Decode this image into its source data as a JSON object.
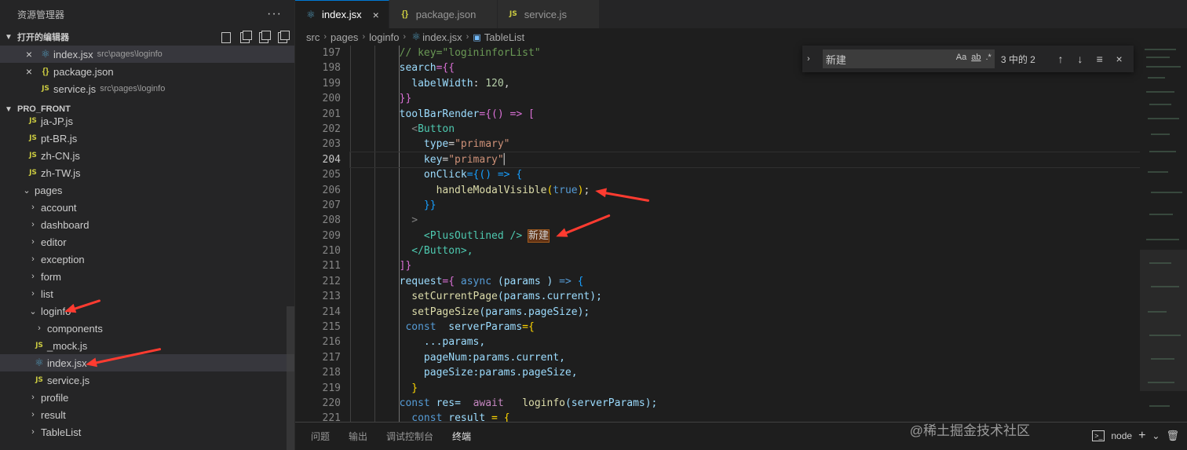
{
  "sidebar": {
    "title": "资源管理器",
    "more": "···",
    "open_editors": {
      "header": "打开的编辑器",
      "items": [
        {
          "close": "×",
          "name": "index.jsx",
          "path": "src\\pages\\loginfo"
        },
        {
          "close": "×",
          "name": "package.json",
          "path": ""
        },
        {
          "name": "service.js",
          "path": "src\\pages\\loginfo"
        }
      ]
    },
    "project": {
      "header": "PRO_FRONT",
      "items": [
        {
          "label": "ja-JP.js"
        },
        {
          "label": "pt-BR.js"
        },
        {
          "label": "zh-CN.js"
        },
        {
          "label": "zh-TW.js"
        },
        {
          "label": "pages"
        },
        {
          "label": "account"
        },
        {
          "label": "dashboard"
        },
        {
          "label": "editor"
        },
        {
          "label": "exception"
        },
        {
          "label": "form"
        },
        {
          "label": "list"
        },
        {
          "label": "loginfo"
        },
        {
          "label": "components"
        },
        {
          "label": "_mock.js"
        },
        {
          "label": "index.jsx"
        },
        {
          "label": "service.js"
        },
        {
          "label": "profile"
        },
        {
          "label": "result"
        },
        {
          "label": "TableList"
        }
      ]
    }
  },
  "tabs": [
    {
      "label": "index.jsx",
      "close": "×"
    },
    {
      "label": "package.json"
    },
    {
      "label": "service.js"
    }
  ],
  "breadcrumb": {
    "parts": [
      "src",
      "pages",
      "loginfo",
      "index.jsx",
      "TableList"
    ],
    "sep": "›"
  },
  "icons": {
    "js": "JS",
    "json": "{}",
    "react": "⚛"
  },
  "find": {
    "value": "新建",
    "opt_case": "Aa",
    "opt_word": "ab",
    "opt_regex": ".*",
    "count": "3 中的 2",
    "prev": "↑",
    "next": "↓",
    "sel": "≡",
    "close": "×"
  },
  "lines": [
    "197",
    "198",
    "199",
    "200",
    "201",
    "202",
    "203",
    "204",
    "205",
    "206",
    "207",
    "208",
    "209",
    "210",
    "211",
    "212",
    "213",
    "214",
    "215",
    "216",
    "217",
    "218",
    "219",
    "220",
    "221"
  ],
  "code": {
    "c197": "// key=\"logininforList\"",
    "search": "search",
    "eqbr": "={{",
    "labelWidth": "labelWidth",
    "lw_val": "120",
    "close200": "}}",
    "toolBarRender": "toolBarRender",
    "eq_arrow": "={() => [",
    "lt": "<",
    "Button": "Button",
    "type": "type",
    "type_val": "\"primary\"",
    "key": "key",
    "key_val": "\"primary\"",
    "onClick": "onClick",
    "onClick_rest": "={() => {",
    "handleModalVisible": "handleModalVisible",
    "true": "true",
    "close207": "}}",
    "gt": ">",
    "plus": "<PlusOutlined />",
    "xinjian": "新建",
    "closeButton": "</Button>,",
    "close211": "]}",
    "request": "request",
    "req_rest1": "={",
    "async": "async",
    "params": "(params )",
    "arrow": "=>",
    "lb": "{",
    "setCurrentPage": "setCurrentPage",
    "scp_arg": "(params.current);",
    "setPageSize": "setPageSize",
    "sps_arg": "(params.pageSize);",
    "const": "const",
    "serverParams": "serverParams",
    "sp_eq": "={",
    "spread": "...params,",
    "pageNum": "pageNum:params.current,",
    "pageSize": "pageSize:params.pageSize,",
    "close219": "}",
    "res": "res=",
    "await": "await",
    "loginfo": "loginfo",
    "loginfo_arg": "(serverParams);",
    "result": "result",
    "res_eq": "= {"
  },
  "panel": {
    "tabs": [
      "问题",
      "输出",
      "调试控制台",
      "终端"
    ],
    "terminal": "node",
    "plus": "+",
    "caret": "⌄",
    "trash": "🗑"
  },
  "watermark": "@稀土掘金技术社区"
}
